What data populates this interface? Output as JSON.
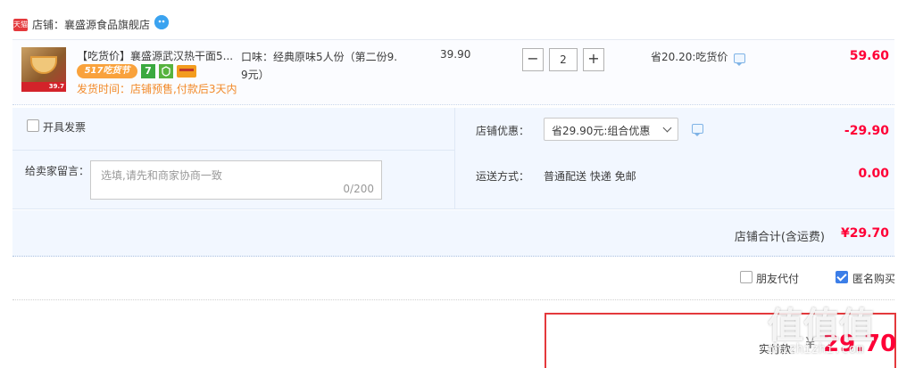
{
  "shop": {
    "badge": "天猫",
    "name": "店铺：襄盛源食品旗舰店",
    "ww_icon": "wangwang-chat-icon"
  },
  "item": {
    "thumb_price_tag": "39.7",
    "title": "【吃货价】襄盛源武汉热干面5...",
    "badge_517": "517吃货节",
    "badge_7": "7",
    "ship_time": "发货时间：店铺预售,付款后3天内",
    "sku_line1": "口味：经典原味5人份（第二份9.",
    "sku_line2": "9元）",
    "unit_price": "39.90",
    "quantity": "2",
    "minus": "−",
    "plus": "+",
    "save_text": "省20.20:吃货价",
    "subtotal": "59.60"
  },
  "options": {
    "invoice_label": "开具发票",
    "message_label": "给卖家留言：",
    "message_placeholder": "选填,请先和商家协商一致",
    "message_count": "0/200",
    "shop_discount_label": "店铺优惠：",
    "shop_discount_select": "省29.90元:组合优惠",
    "shop_discount_value": "-29.90",
    "shipping_label": "运送方式：",
    "shipping_method": "普通配送 快递 免邮",
    "shipping_fee": "0.00"
  },
  "total": {
    "label": "店铺合计(含运费)",
    "value": "¥29.70"
  },
  "footer": {
    "friend_pay_label": "朋友代付",
    "anonymous_label": "匿名购买",
    "anonymous_checked": true,
    "pay_label": "实付款：",
    "pay_currency": "¥",
    "pay_amount": "29.70"
  },
  "watermark": {
    "text": "值值值",
    "url": "zhizhizhi.com"
  }
}
